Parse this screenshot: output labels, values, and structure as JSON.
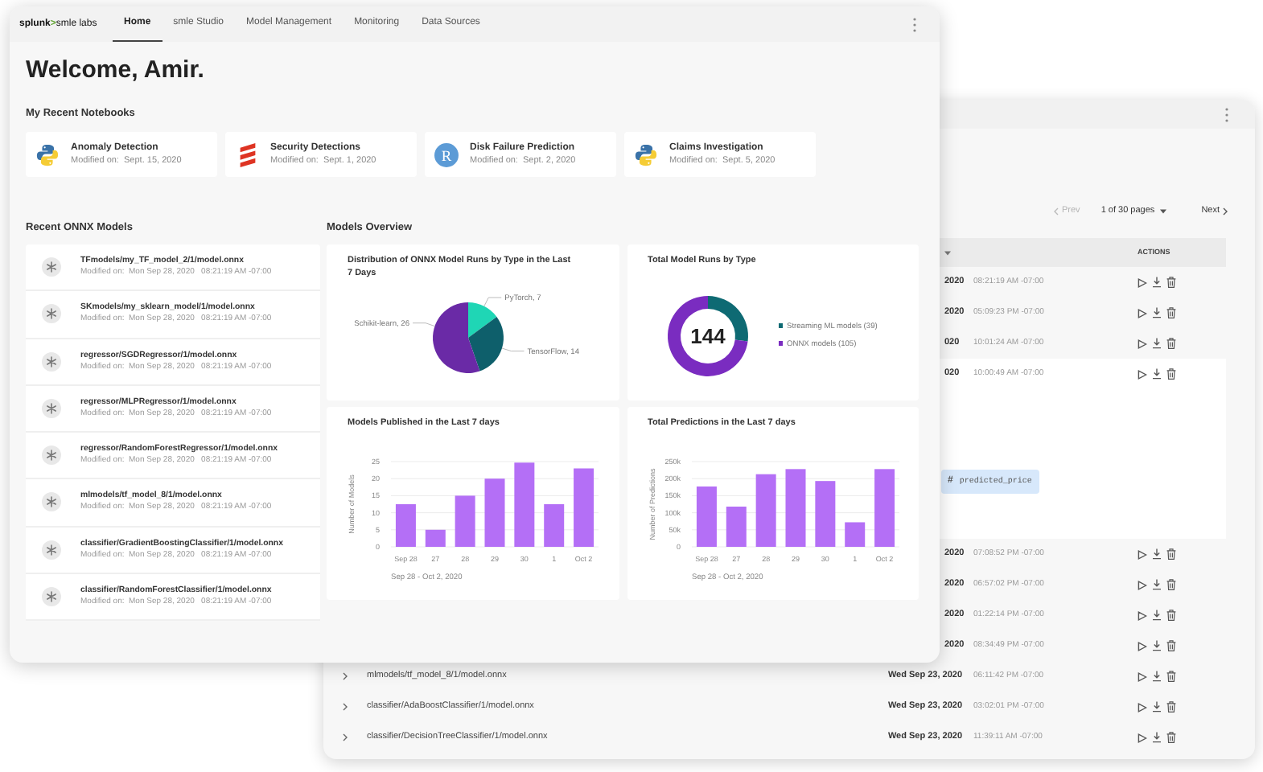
{
  "front_window": {
    "logo": {
      "brand": "splunk",
      "mark": ">",
      "product": "smle labs"
    },
    "tabs": [
      {
        "label": "Home",
        "selected": true
      },
      {
        "label": "smle Studio",
        "selected": false
      },
      {
        "label": "Model Management",
        "selected": false
      },
      {
        "label": "Monitoring",
        "selected": false
      },
      {
        "label": "Data Sources",
        "selected": false
      }
    ],
    "heading": "Welcome, Amir.",
    "notebooks_title": "My Recent Notebooks",
    "notebooks": [
      {
        "title": "Anomaly Detection",
        "modified": "Modified on:  Sept. 15, 2020",
        "kind": "python"
      },
      {
        "title": "Security Detections",
        "modified": "Modified on:  Sept. 1, 2020",
        "kind": "scala"
      },
      {
        "title": "Disk Failure Prediction",
        "modified": "Modified on:  Sept. 2, 2020",
        "kind": "r",
        "icon_letter": "R"
      },
      {
        "title": "Claims Investigation",
        "modified": "Modified on:  Sept. 5, 2020",
        "kind": "python"
      }
    ],
    "models_title": "Recent ONNX Models",
    "models": [
      {
        "path": "TFmodels/my_TF_model_2/1/model.onnx",
        "modified": "Modified on:  Mon Sep 28, 2020   08:21:19 AM -07:00"
      },
      {
        "path": "SKmodels/my_sklearn_model/1/model.onnx",
        "modified": "Modified on:  Mon Sep 28, 2020   08:21:19 AM -07:00"
      },
      {
        "path": "regressor/SGDRegressor/1/model.onnx",
        "modified": "Modified on:  Mon Sep 28, 2020   08:21:19 AM -07:00"
      },
      {
        "path": "regressor/MLPRegressor/1/model.onnx",
        "modified": "Modified on:  Mon Sep 28, 2020   08:21:19 AM -07:00"
      },
      {
        "path": "regressor/RandomForestRegressor/1/model.onnx",
        "modified": "Modified on:  Mon Sep 28, 2020   08:21:19 AM -07:00"
      },
      {
        "path": "mlmodels/tf_model_8/1/model.onnx",
        "modified": "Modified on:  Mon Sep 28, 2020   08:21:19 AM -07:00"
      },
      {
        "path": "classifier/GradientBoostingClassifier/1/model.onnx",
        "modified": "Modified on:  Mon Sep 28, 2020   08:21:19 AM -07:00"
      },
      {
        "path": "classifier/RandomForestClassifier/1/model.onnx",
        "modified": "Modified on:  Mon Sep 28, 2020   08:21:19 AM -07:00"
      }
    ],
    "overview_title": "Models Overview",
    "charts": [
      {
        "chart_data": {
          "type": "pie",
          "title": "Distribution of ONNX Model Runs by Type in the Last 7 Days",
          "values": [
            7,
            14,
            26
          ],
          "colors": [
            "#1fd6b5",
            "#0e5f6b",
            "#6a2aa6"
          ],
          "value_labels": [
            "PyTorch, 7",
            "TensorFlow, 14",
            "Schikit-learn, 26"
          ]
        }
      },
      {
        "total": "144",
        "chart_data": {
          "type": "donut",
          "title": "Total Model Runs by Type",
          "categories": [
            "Streaming ML models (39)",
            "ONNX models (105)"
          ],
          "values": [
            39,
            105
          ],
          "colors": [
            "#0e6a73",
            "#7a2cc0"
          ],
          "legend": true
        }
      },
      {
        "chart_data": {
          "type": "bar",
          "grid": true,
          "title": "Models Published in the Last 7 days",
          "categories": [
            "Sep 28",
            "27",
            "28",
            "29",
            "30",
            "1",
            "Oct 2"
          ],
          "series": [
            {
              "color": "#b46ff6",
              "values": [
                12.5,
                5,
                15,
                20,
                24.7,
                12.5,
                23
              ]
            }
          ],
          "xlabel": "Sep 28 - Oct 2, 2020",
          "ylabel": "Number of Models",
          "ylim": [
            0,
            25
          ],
          "yticks": [
            0,
            5,
            10,
            15,
            20,
            25
          ]
        }
      },
      {
        "chart_data": {
          "type": "bar",
          "grid": true,
          "title": "Total Predictions in the Last 7 days",
          "categories": [
            "Sep 28",
            "27",
            "28",
            "29",
            "30",
            "1",
            "Oct 2"
          ],
          "series": [
            {
              "color": "#b46ff6",
              "values": [
                177000,
                118000,
                213000,
                228000,
                193000,
                72000,
                228000
              ]
            }
          ],
          "xlabel": "Sep 28 - Oct 2, 2020",
          "ylabel": "Number of Predictions",
          "ylim": [
            0,
            250000
          ],
          "yticks": [
            {
              "value": 0,
              "label": "0"
            },
            {
              "value": 50000,
              "label": "50k"
            },
            {
              "value": 100000,
              "label": "100k"
            },
            {
              "value": 150000,
              "label": "150k"
            },
            {
              "value": 200000,
              "label": "200k"
            },
            {
              "value": 250000,
              "label": "250k"
            }
          ]
        }
      }
    ]
  },
  "back_window": {
    "pagination": {
      "prev": "Prev",
      "prev_disabled": true,
      "page": "1 of 30 pages",
      "next": "Next"
    },
    "actions_header": "ACTIONS",
    "rows": [
      {
        "date": "2020",
        "time": "08:21:19 AM -07:00"
      },
      {
        "date": "2020",
        "time": "05:09:23 PM -07:00"
      },
      {
        "date": "020",
        "time": "10:01:24 AM -07:00"
      },
      {
        "date": "020",
        "time": "10:00:49 AM -07:00",
        "expanded": true,
        "chip": {
          "symbol": "#",
          "label": "predicted_price"
        }
      },
      {
        "date": "2020",
        "time": "07:08:52 PM -07:00"
      },
      {
        "date": "2020",
        "time": "06:57:02 PM -07:00"
      },
      {
        "date": "2020",
        "time": "01:22:14 PM -07:00"
      },
      {
        "date": "2020",
        "time": "08:34:49 PM -07:00"
      },
      {
        "name": "mlmodels/tf_model_8/1/model.onnx",
        "date": "Wed Sep 23, 2020",
        "time": "06:11:42 PM -07:00"
      },
      {
        "name": "classifier/AdaBoostClassifier/1/model.onnx",
        "date": "Wed Sep 23, 2020",
        "time": "03:02:01 PM -07:00"
      },
      {
        "name": "classifier/DecisionTreeClassifier/1/model.onnx",
        "date": "Wed Sep 23, 2020",
        "time": "11:39:11 AM -07:00"
      }
    ]
  }
}
